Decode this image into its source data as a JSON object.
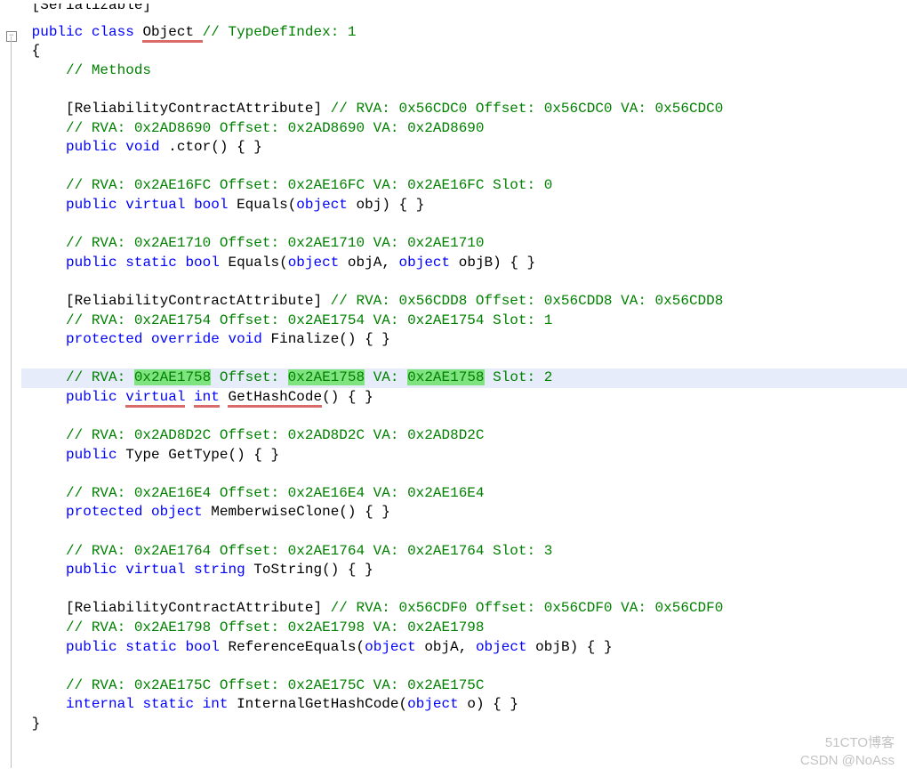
{
  "top": {
    "serializable": "[Serializable]",
    "decl_pre": "public",
    "decl_class": "class",
    "decl_name": "Object",
    "decl_comment": "// TypeDefIndex: 1",
    "open_brace": "{",
    "close_brace": "}"
  },
  "sec": {
    "methods_label": "// Methods"
  },
  "m0": {
    "attr": "[ReliabilityContractAttribute]",
    "attr_comment": "// RVA: 0x56CDC0 Offset: 0x56CDC0 VA: 0x56CDC0",
    "rva_line": "// RVA: 0x2AD8690 Offset: 0x2AD8690 VA: 0x2AD8690",
    "kw1": "public",
    "kw2": "void",
    "name": ".ctor",
    "rest": "() { }"
  },
  "m1": {
    "rva_line": "// RVA: 0x2AE16FC Offset: 0x2AE16FC VA: 0x2AE16FC Slot: 0",
    "kw1": "public",
    "kw2": "virtual",
    "kw3": "bool",
    "name": "Equals",
    "p_open": "(",
    "p_kw": "object",
    "p_name": "obj",
    "p_close": ")",
    "rest": " { }"
  },
  "m2": {
    "rva_line": "// RVA: 0x2AE1710 Offset: 0x2AE1710 VA: 0x2AE1710",
    "kw1": "public",
    "kw2": "static",
    "kw3": "bool",
    "name": "Equals",
    "p_open": "(",
    "pA_kw": "object",
    "pA_name": "objA",
    "sep": ", ",
    "pB_kw": "object",
    "pB_name": "objB",
    "p_close": ")",
    "rest": " { }"
  },
  "m3": {
    "attr": "[ReliabilityContractAttribute]",
    "attr_comment": "// RVA: 0x56CDD8 Offset: 0x56CDD8 VA: 0x56CDD8",
    "rva_line": "// RVA: 0x2AE1754 Offset: 0x2AE1754 VA: 0x2AE1754 Slot: 1",
    "kw1": "protected",
    "kw2": "override",
    "kw3": "void",
    "name": "Finalize",
    "rest": "() { }"
  },
  "m4": {
    "rva_pref": "// RVA: ",
    "rva_v": "0x2AE1758",
    "off_pref": " Offset: ",
    "off_v": "0x2AE1758",
    "va_pref": " VA: ",
    "va_v": "0x2AE1758",
    "tail": " Slot: 2",
    "kw1": "public",
    "kw2": "virtual",
    "kw3": "int",
    "name": "GetHashCode",
    "rest": "() { }"
  },
  "m5": {
    "rva_line": "// RVA: 0x2AD8D2C Offset: 0x2AD8D2C VA: 0x2AD8D2C",
    "kw1": "public",
    "name_type": "Type",
    "name": "GetType",
    "rest": "() { }"
  },
  "m6": {
    "rva_line": "// RVA: 0x2AE16E4 Offset: 0x2AE16E4 VA: 0x2AE16E4",
    "kw1": "protected",
    "kw2": "object",
    "name": "MemberwiseClone",
    "rest": "() { }"
  },
  "m7": {
    "rva_line": "// RVA: 0x2AE1764 Offset: 0x2AE1764 VA: 0x2AE1764 Slot: 3",
    "kw1": "public",
    "kw2": "virtual",
    "kw3": "string",
    "name": "ToString",
    "rest": "() { }"
  },
  "m8": {
    "attr": "[ReliabilityContractAttribute]",
    "attr_comment": "// RVA: 0x56CDF0 Offset: 0x56CDF0 VA: 0x56CDF0",
    "rva_line": "// RVA: 0x2AE1798 Offset: 0x2AE1798 VA: 0x2AE1798",
    "kw1": "public",
    "kw2": "static",
    "kw3": "bool",
    "name": "ReferenceEquals",
    "p_open": "(",
    "pA_kw": "object",
    "pA_name": "objA",
    "sep": ", ",
    "pB_kw": "object",
    "pB_name": "objB",
    "p_close": ")",
    "rest": " { }"
  },
  "m9": {
    "rva_line": "// RVA: 0x2AE175C Offset: 0x2AE175C VA: 0x2AE175C",
    "kw1": "internal",
    "kw2": "static",
    "kw3": "int",
    "name": "InternalGetHashCode",
    "p_open": "(",
    "p_kw": "object",
    "p_name": "o",
    "p_close": ")",
    "rest": " { }"
  },
  "watermarks": {
    "w1": "51CTO博客",
    "w2": "CSDN @NoAss"
  }
}
